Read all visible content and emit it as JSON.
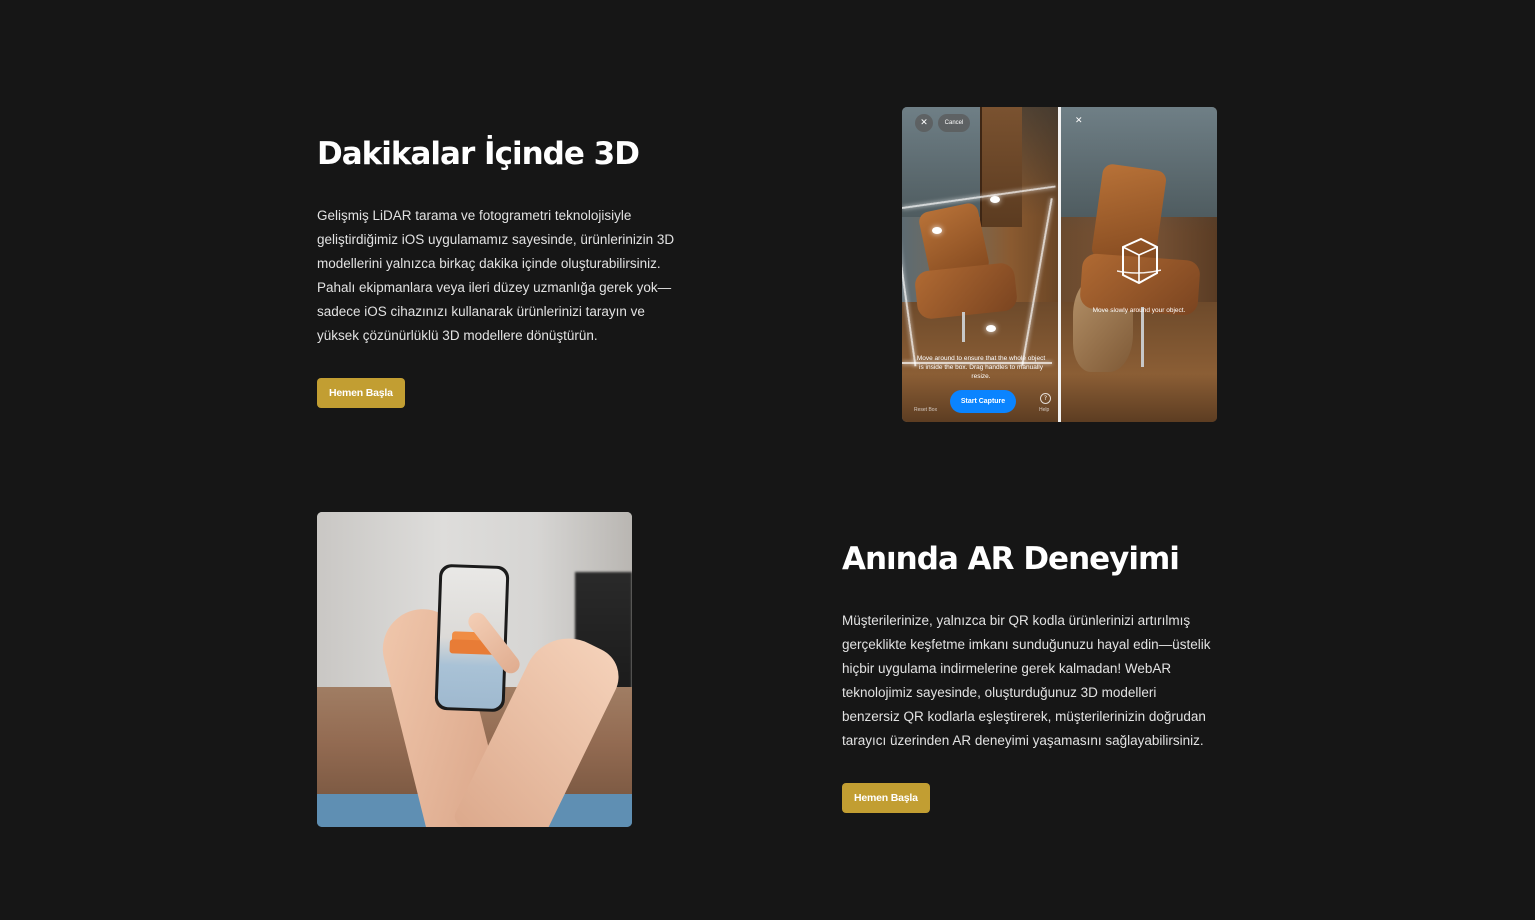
{
  "section1": {
    "title": "Dakikalar İçinde 3D",
    "body": "Gelişmiş LiDAR tarama ve fotogrametri teknolojisiyle geliştirdiğimiz iOS uygulamamız sayesinde, ürünlerinizin 3D modellerini yalnızca birkaç dakika içinde oluşturabilirsiniz. Pahalı ekipmanlara veya ileri düzey uzmanlığa gerek yok—sadece iOS cihazınızı kullanarak ürünlerinizi tarayın ve yüksek çözünürlüklü 3D modellere dönüştürün.",
    "cta_label": "Hemen Başla",
    "image": {
      "cancel_label": "Cancel",
      "capture_hint": "Move around to ensure that the whole object is inside the box. Drag handles to manually resize.",
      "start_capture_label": "Start Capture",
      "reset_label": "Reset Box",
      "help_label": "Help",
      "move_hint": "Move slowly around your object."
    }
  },
  "section2": {
    "title": "Anında AR Deneyimi",
    "body": "Müşterilerinize, yalnızca bir QR kodla ürünlerinizi artırılmış gerçeklikte keşfetme imkanı sunduğunuzu hayal edin—üstelik hiçbir uygulama indirmelerine gerek kalmadan! WebAR teknolojimiz sayesinde, oluşturduğunuz 3D modelleri benzersiz QR kodlarla eşleştirerek, müşterilerinizin doğrudan tarayıcı üzerinden AR deneyimi yaşamasını sağlayabilirsiniz.",
    "cta_label": "Hemen Başla"
  },
  "colors": {
    "background": "#161616",
    "accent": "#c29e32",
    "capture_blue": "#0a84ff"
  },
  "icons": {
    "close": "close-icon",
    "help": "help-icon",
    "scan_cube": "cube-scan-icon"
  }
}
